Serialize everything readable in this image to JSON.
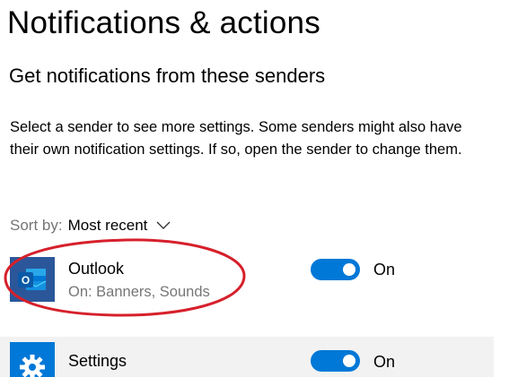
{
  "header": {
    "title": "Notifications & actions"
  },
  "section": {
    "title": "Get notifications from these senders",
    "description": "Select a sender to see more settings. Some senders might also have their own notification settings. If so, open the sender to change them."
  },
  "sort": {
    "label": "Sort by:",
    "value": "Most recent",
    "icon": "chevron-down-icon"
  },
  "senders": [
    {
      "name": "Outlook",
      "detail": "On: Banners, Sounds",
      "icon": "outlook-app-icon",
      "toggle_on": true,
      "toggle_label": "On"
    },
    {
      "name": "Settings",
      "icon": "gear-icon",
      "toggle_on": true,
      "toggle_label": "On"
    }
  ],
  "colors": {
    "accent": "#0078d7",
    "outlook_tile": "#2b579a",
    "secondary_text": "#767676",
    "annotation_circle": "#d6202b",
    "highlight_row": "#f2f2f2"
  }
}
